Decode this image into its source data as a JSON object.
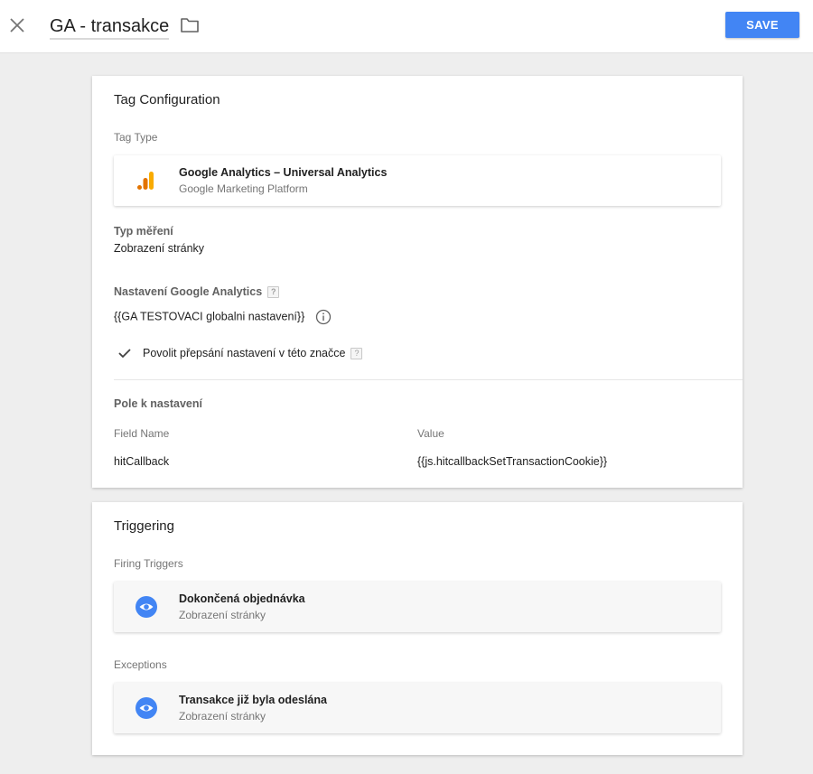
{
  "header": {
    "title": "GA - transakce",
    "save_label": "SAVE",
    "close_icon": "close-icon",
    "folder_icon": "folder-icon"
  },
  "tag_config": {
    "title": "Tag Configuration",
    "tag_type_label": "Tag Type",
    "tag_type": {
      "name": "Google Analytics – Universal Analytics",
      "vendor": "Google Marketing Platform",
      "icon": "google-analytics-icon"
    },
    "tracking_type_label": "Typ měření",
    "tracking_type_value": "Zobrazení stránky",
    "ga_settings_label": "Nastavení Google Analytics",
    "ga_settings_value": "{{GA TESTOVACI globalni nastavení}}",
    "override_label": "Povolit přepsání nastavení v této značce",
    "override_checked": true,
    "fields_section_label": "Pole k nastavení",
    "fields_headers": {
      "name": "Field Name",
      "value": "Value"
    },
    "fields": [
      {
        "name": "hitCallback",
        "value": "{{js.hitcallbackSetTransactionCookie}}"
      }
    ]
  },
  "triggering": {
    "title": "Triggering",
    "firing_label": "Firing Triggers",
    "firing": [
      {
        "name": "Dokončená objednávka",
        "type": "Zobrazení stránky",
        "icon": "eye-icon"
      }
    ],
    "exceptions_label": "Exceptions",
    "exceptions": [
      {
        "name": "Transakce již byla odeslána",
        "type": "Zobrazení stránky",
        "icon": "eye-icon"
      }
    ]
  },
  "colors": {
    "accent": "#4285f4",
    "ga_orange": "#f9ab00",
    "ga_dark_orange": "#e37400"
  }
}
